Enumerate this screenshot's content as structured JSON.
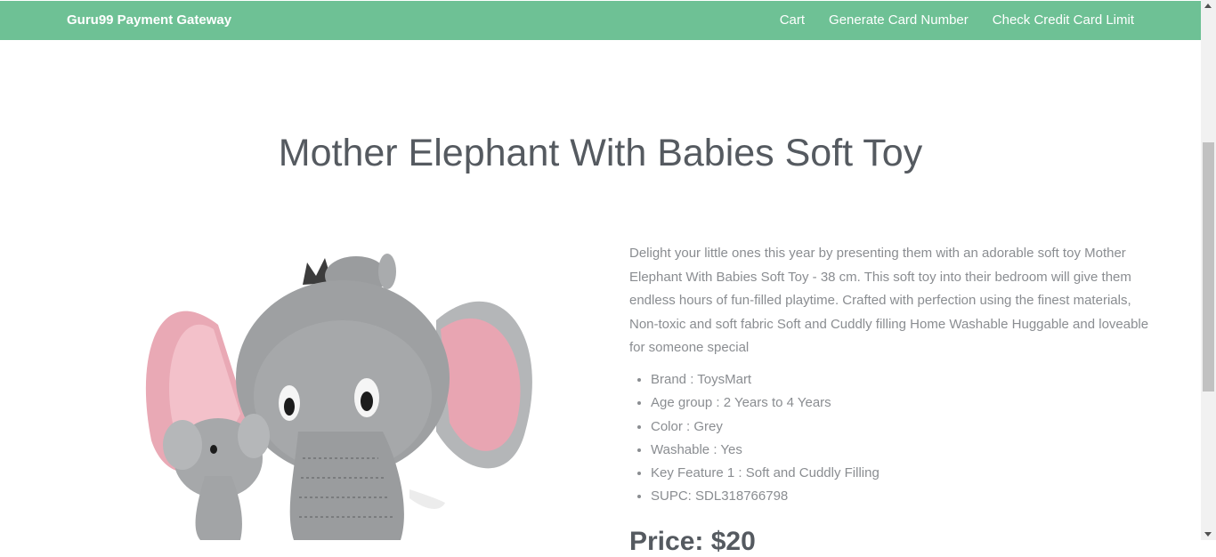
{
  "navbar": {
    "brand": "Guru99 Payment Gateway",
    "links": [
      "Cart",
      "Generate Card Number",
      "Check Credit Card Limit"
    ]
  },
  "product": {
    "title": "Mother Elephant With Babies Soft Toy",
    "description": "Delight your little ones this year by presenting them with an adorable soft toy Mother Elephant With Babies Soft Toy - 38 cm. This soft toy into their bedroom will give them endless hours of fun-filled playtime. Crafted with perfection using the finest materials, Non-toxic and soft fabric Soft and Cuddly filling Home Washable Huggable and loveable for someone special",
    "features": [
      "Brand : ToysMart",
      "Age group : 2 Years to 4 Years",
      "Color : Grey",
      "Washable : Yes",
      "Key Feature 1 : Soft and Cuddly Filling",
      "SUPC: SDL318766798"
    ],
    "price": "Price: $20"
  },
  "colors": {
    "nav": "#6ec195",
    "text": "#8a8d91",
    "title": "#555a60"
  }
}
